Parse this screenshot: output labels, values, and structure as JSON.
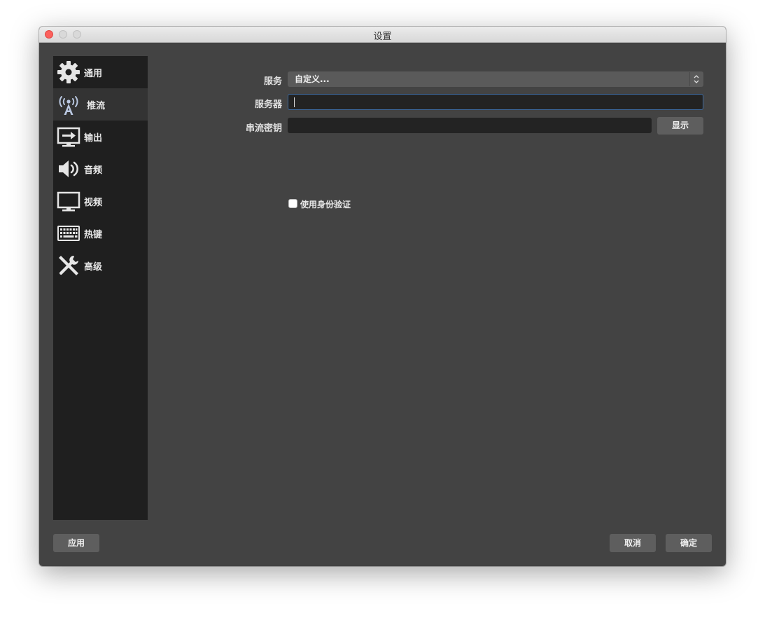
{
  "window": {
    "title": "设置"
  },
  "sidebar": {
    "items": [
      {
        "label": "通用",
        "icon": "gear-icon"
      },
      {
        "label": "推流",
        "icon": "broadcast-antenna-icon",
        "active": true
      },
      {
        "label": "输出",
        "icon": "output-monitor-icon"
      },
      {
        "label": "音频",
        "icon": "speaker-icon"
      },
      {
        "label": "视频",
        "icon": "monitor-icon"
      },
      {
        "label": "热键",
        "icon": "keyboard-icon"
      },
      {
        "label": "高级",
        "icon": "tools-icon"
      }
    ]
  },
  "stream": {
    "service_label": "服务",
    "service_value": "自定义...",
    "server_label": "服务器",
    "server_value": "",
    "key_label": "串流密钥",
    "key_value": "",
    "show_button": "显示",
    "auth_checkbox_label": "使用身份验证",
    "auth_checked": false
  },
  "footer": {
    "apply": "应用",
    "cancel": "取消",
    "ok": "确定"
  },
  "colors": {
    "window_bg": "#434343",
    "sidebar_bg": "#1f1f1f",
    "active_item_bg": "#333333",
    "input_bg": "#232323",
    "focus_border": "#3d6aa0",
    "button_bg": "#5e5e5e",
    "close_button": "#fc615d"
  }
}
